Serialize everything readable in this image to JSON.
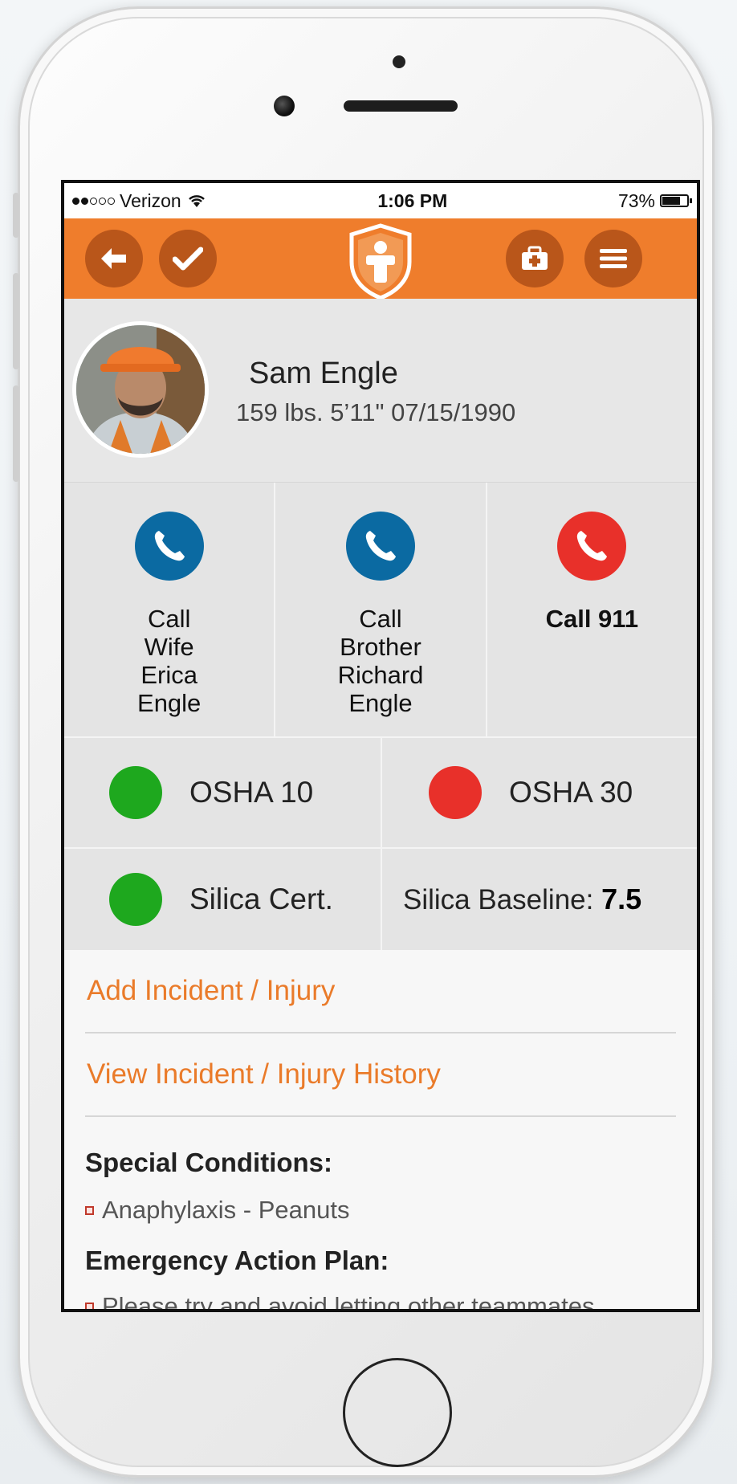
{
  "status_bar": {
    "carrier": "Verizon",
    "time": "1:06 PM",
    "battery_percent": "73%",
    "battery_level": 0.73
  },
  "nav": {
    "back_icon": "back-arrow-icon",
    "check_icon": "check-icon",
    "logo_icon": "shield-cross-person-logo",
    "firstaid_icon": "first-aid-kit-icon",
    "menu_icon": "hamburger-menu-icon",
    "accent_color": "#ef7d2c",
    "button_color": "#b9561a"
  },
  "profile": {
    "name": "Sam Engle",
    "details": "159 lbs. 5’11\" 07/15/1990"
  },
  "contacts": [
    {
      "label": "Call\nWife\nErica\nEngle",
      "color": "#0b6aa2",
      "icon": "phone-icon"
    },
    {
      "label": "Call\nBrother\nRichard\nEngle",
      "color": "#0b6aa2",
      "icon": "phone-icon"
    },
    {
      "label": "Call 911",
      "color": "#e8302a",
      "icon": "phone-icon"
    }
  ],
  "certs": {
    "osha10": {
      "label": "OSHA 10",
      "status_color": "#1ea81e"
    },
    "osha30": {
      "label": "OSHA 30",
      "status_color": "#e8302a"
    },
    "silica_cert": {
      "label": "Silica Cert.",
      "status_color": "#1ea81e"
    },
    "silica_baseline": {
      "label": "Silica Baseline:",
      "value": "7.5"
    }
  },
  "links": {
    "add_incident": "Add Incident / Injury",
    "view_history": "View Incident / Injury History"
  },
  "special_conditions": {
    "title": "Special Conditions:",
    "items": [
      "Anaphylaxis - Peanuts"
    ]
  },
  "emergency_plan": {
    "title": "Emergency Action Plan:",
    "first_item": "Please try and avoid letting other teammates"
  }
}
